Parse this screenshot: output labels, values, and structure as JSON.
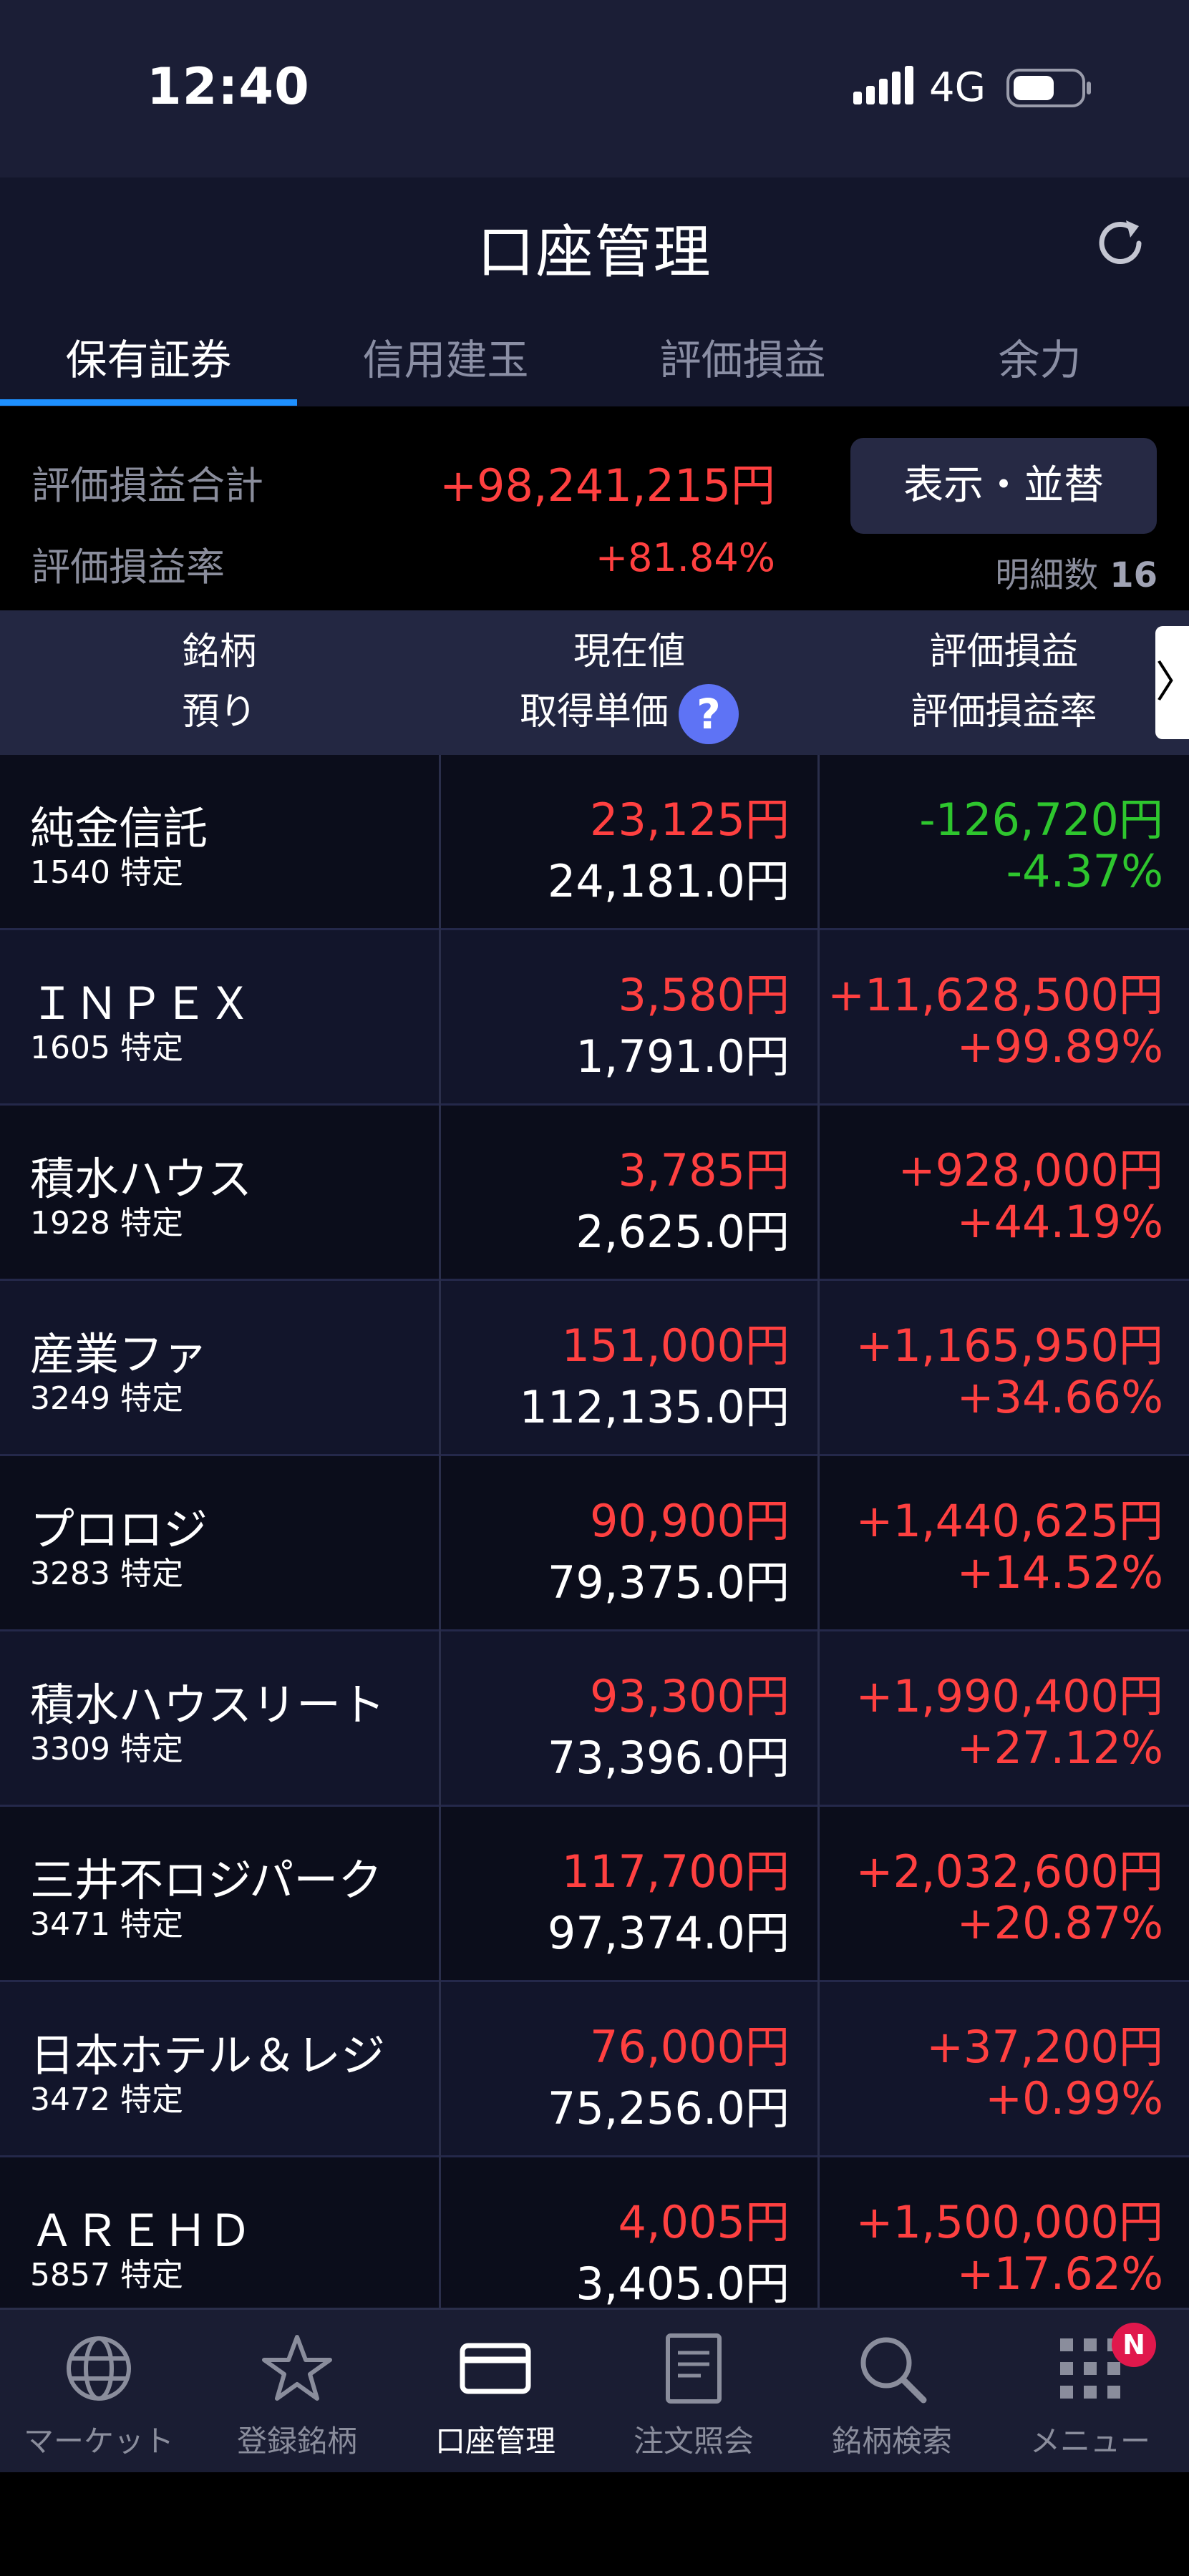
{
  "statusbar": {
    "time": "12:40",
    "network": "4G"
  },
  "header": {
    "title": "口座管理",
    "refresh_icon": "refresh-icon"
  },
  "tabs": [
    {
      "label": "保有証券",
      "active": true
    },
    {
      "label": "信用建玉",
      "active": false
    },
    {
      "label": "評価損益",
      "active": false
    },
    {
      "label": "余力",
      "active": false
    }
  ],
  "summary": {
    "total_label": "評価損益合計",
    "total_value": "+98,241,215円",
    "rate_label": "評価損益率",
    "rate_value": "+81.84%",
    "display_button": "表示・並替",
    "count_label": "明細数",
    "count_value": "16"
  },
  "columns": {
    "col1_line1": "銘柄",
    "col1_line2": "預り",
    "col2_line1": "現在値",
    "col2_line2": "取得単価",
    "help": "?",
    "col3_line1": "評価損益",
    "col3_line2": "評価損益率",
    "scroll_arrow": "〉"
  },
  "holdings": [
    {
      "name": "純金信託",
      "code": "1540 特定",
      "price": "23,125円",
      "cost": "24,181.0円",
      "pl": "-126,720円",
      "rate": "-4.37%",
      "positive": false
    },
    {
      "name": "ＩＮＰＥＸ",
      "code": "1605 特定",
      "price": "3,580円",
      "cost": "1,791.0円",
      "pl": "+11,628,500円",
      "rate": "+99.89%",
      "positive": true
    },
    {
      "name": "積水ハウス",
      "code": "1928 特定",
      "price": "3,785円",
      "cost": "2,625.0円",
      "pl": "+928,000円",
      "rate": "+44.19%",
      "positive": true
    },
    {
      "name": "産業ファ",
      "code": "3249 特定",
      "price": "151,000円",
      "cost": "112,135.0円",
      "pl": "+1,165,950円",
      "rate": "+34.66%",
      "positive": true
    },
    {
      "name": "プロロジ",
      "code": "3283 特定",
      "price": "90,900円",
      "cost": "79,375.0円",
      "pl": "+1,440,625円",
      "rate": "+14.52%",
      "positive": true
    },
    {
      "name": "積水ハウスリート",
      "code": "3309 特定",
      "price": "93,300円",
      "cost": "73,396.0円",
      "pl": "+1,990,400円",
      "rate": "+27.12%",
      "positive": true
    },
    {
      "name": "三井不ロジパーク",
      "code": "3471 特定",
      "price": "117,700円",
      "cost": "97,374.0円",
      "pl": "+2,032,600円",
      "rate": "+20.87%",
      "positive": true
    },
    {
      "name": "日本ホテル＆レジ",
      "code": "3472 特定",
      "price": "76,000円",
      "cost": "75,256.0円",
      "pl": "+37,200円",
      "rate": "+0.99%",
      "positive": true
    },
    {
      "name": "ＡＲＥＨＤ",
      "code": "5857 特定",
      "price": "4,005円",
      "cost": "3,405.0円",
      "pl": "+1,500,000円",
      "rate": "+17.62%",
      "positive": true
    }
  ],
  "colors": {
    "positive": "#ff4040",
    "negative": "#2ec62e",
    "accent": "#1e90ff"
  },
  "nav": [
    {
      "label": "マーケット",
      "icon": "globe-icon",
      "active": false
    },
    {
      "label": "登録銘柄",
      "icon": "star-icon",
      "active": false
    },
    {
      "label": "口座管理",
      "icon": "wallet-card-icon",
      "active": true
    },
    {
      "label": "注文照会",
      "icon": "document-icon",
      "active": false
    },
    {
      "label": "銘柄検索",
      "icon": "search-icon",
      "active": false
    },
    {
      "label": "メニュー",
      "icon": "grid-menu-icon",
      "active": false,
      "badge": "N"
    }
  ]
}
